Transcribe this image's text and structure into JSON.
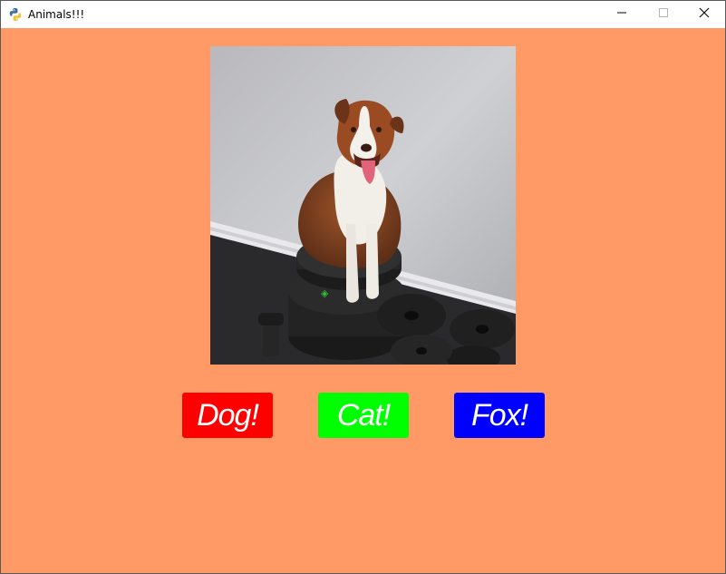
{
  "window": {
    "title": "Animals!!!",
    "app_icon": "python-snake-icon",
    "controls": {
      "minimize_icon": "minimize-icon",
      "maximize_icon": "maximize-icon",
      "close_icon": "close-icon"
    }
  },
  "colors": {
    "background": "#ff9966",
    "titlebar": "#ffffff"
  },
  "main": {
    "image": {
      "subject": "Australian Shepherd dog sitting on stacked weight plates"
    },
    "buttons": [
      {
        "label": "Dog!",
        "bg_color": "#ff0000",
        "text_color": "#ffffff"
      },
      {
        "label": "Cat!",
        "bg_color": "#00ff00",
        "text_color": "#ffffff"
      },
      {
        "label": "Fox!",
        "bg_color": "#0000ff",
        "text_color": "#ffffff"
      }
    ]
  }
}
